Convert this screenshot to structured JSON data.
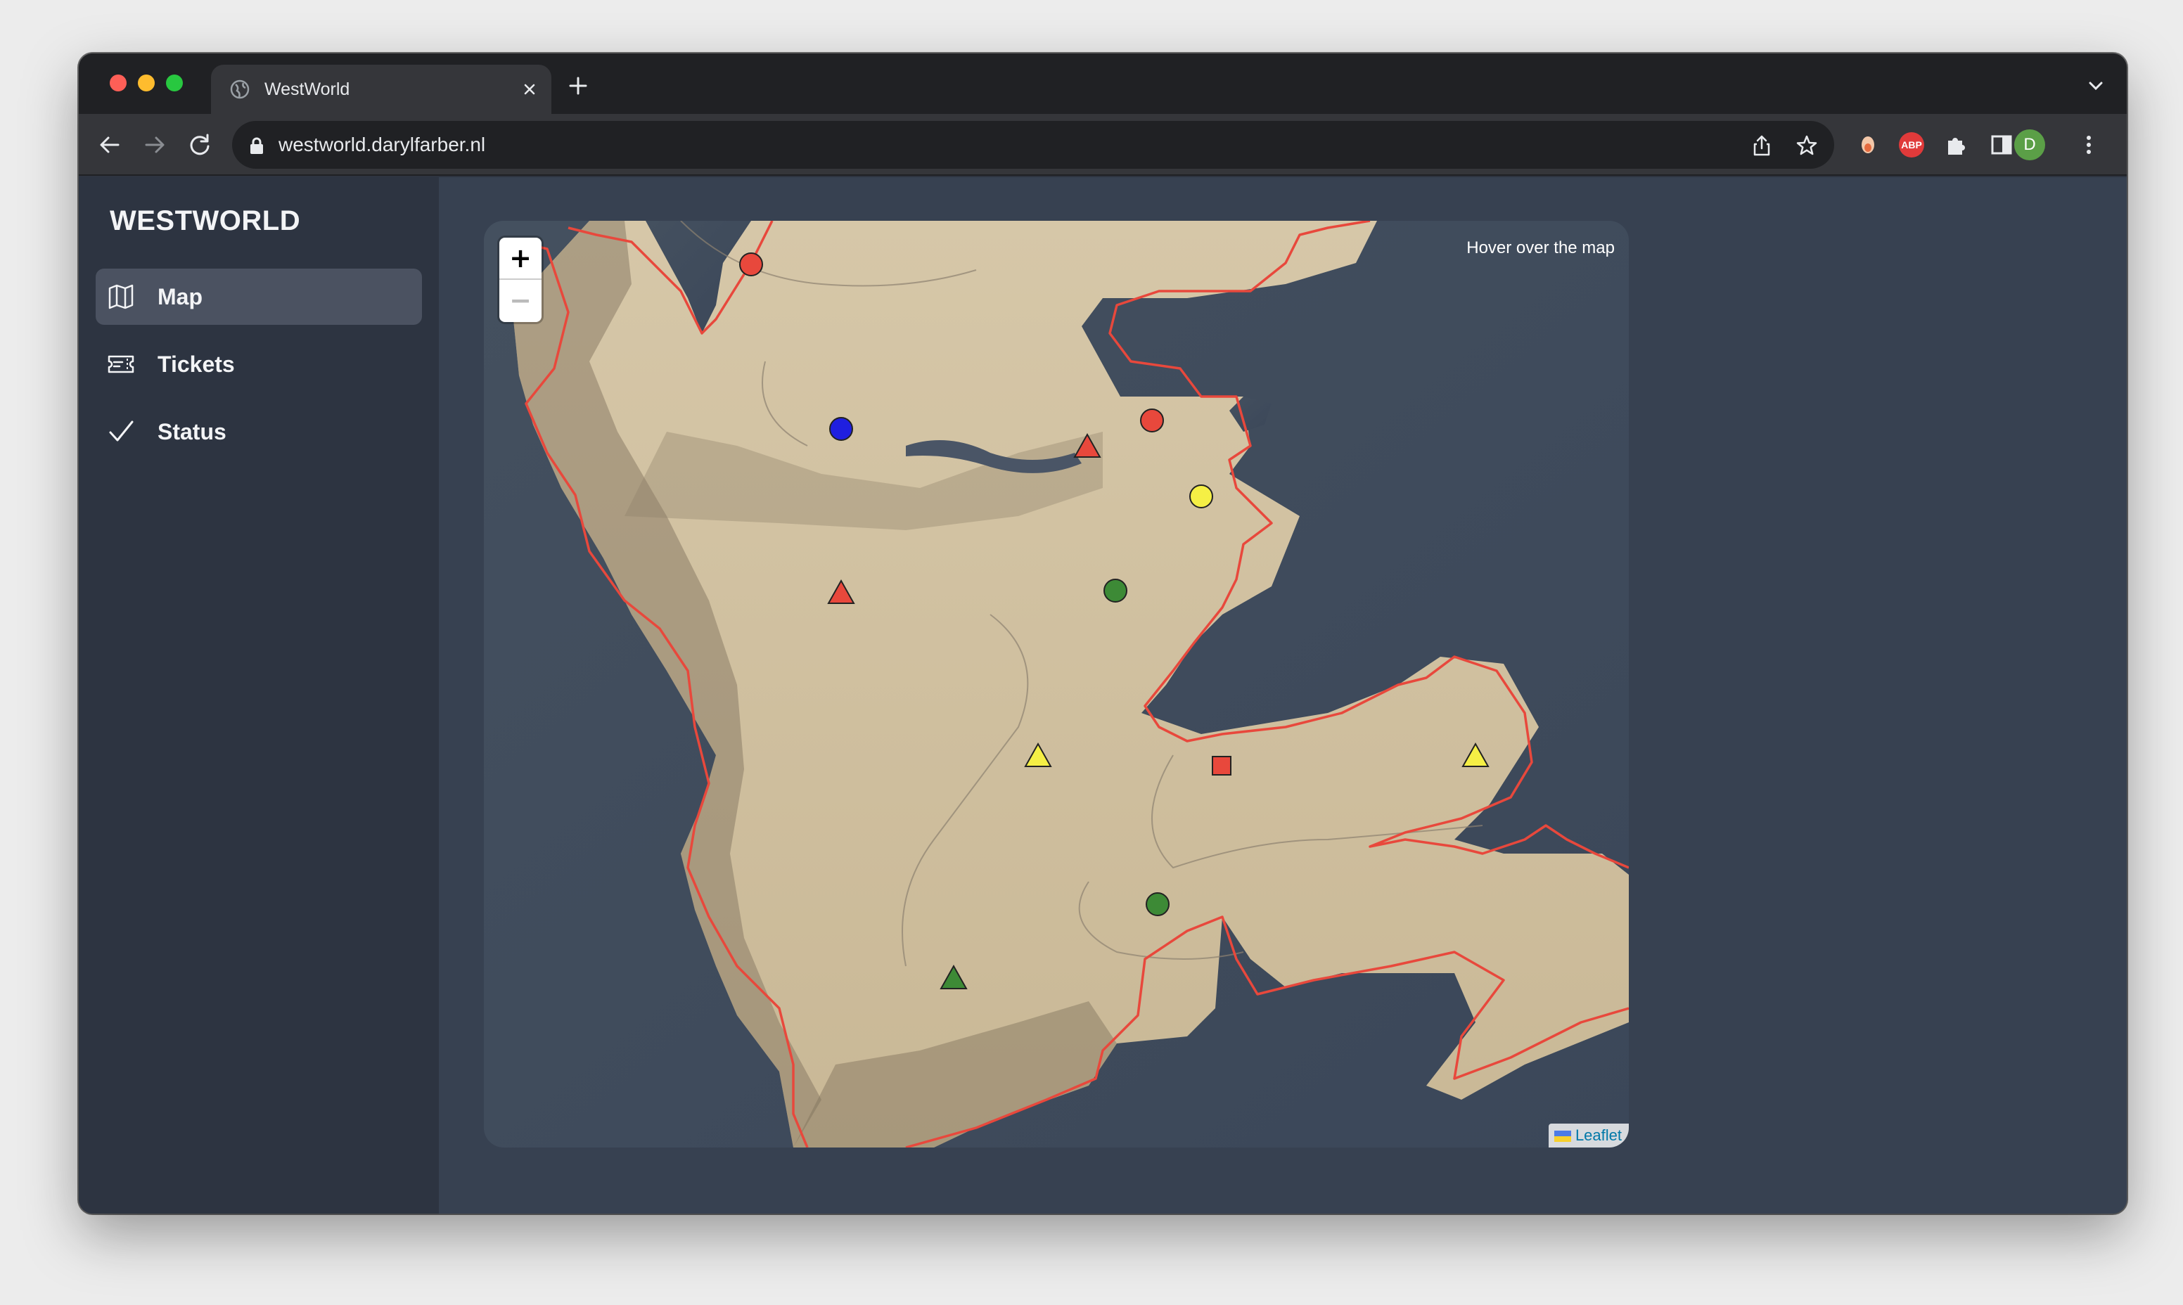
{
  "browser": {
    "tab_title": "WestWorld",
    "url": "westworld.darylfarber.nl",
    "profile_initial": "D",
    "extension_abp_label": "ABP"
  },
  "sidebar": {
    "brand": "WESTWORLD",
    "items": [
      {
        "label": "Map",
        "icon": "map-icon",
        "active": true
      },
      {
        "label": "Tickets",
        "icon": "ticket-icon",
        "active": false
      },
      {
        "label": "Status",
        "icon": "checkmark-icon",
        "active": false
      }
    ]
  },
  "map": {
    "zoom_in_label": "+",
    "zoom_out_label": "−",
    "hover_info": "Hover over the map",
    "attribution_link": "Leaflet",
    "colors": {
      "border": "#e8483c",
      "land": "#cfbf9f",
      "sea": "#3a4556",
      "marker_red": "#e8483c",
      "marker_yellow": "#f5ef45",
      "marker_green": "#3d8a36",
      "marker_blue": "#1f1fe0"
    },
    "markers": [
      {
        "shape": "circle",
        "color": "red"
      },
      {
        "shape": "circle",
        "color": "blue"
      },
      {
        "shape": "triangle",
        "color": "red"
      },
      {
        "shape": "circle",
        "color": "red"
      },
      {
        "shape": "circle",
        "color": "yellow"
      },
      {
        "shape": "triangle",
        "color": "red"
      },
      {
        "shape": "circle",
        "color": "green"
      },
      {
        "shape": "triangle",
        "color": "yellow"
      },
      {
        "shape": "square",
        "color": "red"
      },
      {
        "shape": "triangle",
        "color": "yellow"
      },
      {
        "shape": "circle",
        "color": "green"
      },
      {
        "shape": "triangle",
        "color": "green"
      }
    ]
  }
}
